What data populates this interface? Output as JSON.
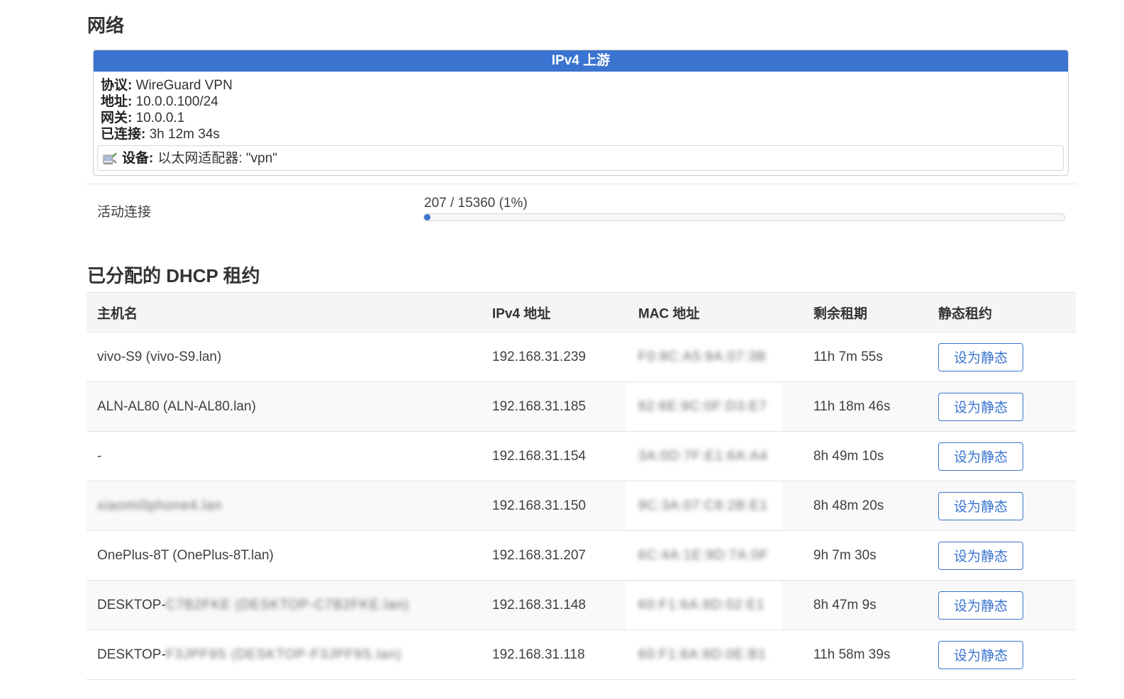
{
  "network": {
    "title": "网络",
    "upstream": {
      "header": "IPv4 上游",
      "protocol_label": "协议:",
      "protocol_value": "WireGuard VPN",
      "address_label": "地址:",
      "address_value": "10.0.0.100/24",
      "gateway_label": "网关:",
      "gateway_value": "10.0.0.1",
      "connected_label": "已连接:",
      "connected_value": "3h 12m 34s",
      "device_label": "设备:",
      "device_value": "以太网适配器: \"vpn\"",
      "device_icon": "ethernet-adapter-icon"
    },
    "active_connections": {
      "label": "活动连接",
      "value": "207 / 15360 (1%)",
      "percent": 1
    }
  },
  "dhcp": {
    "title": "已分配的 DHCP 租约",
    "columns": {
      "host": "主机名",
      "ip": "IPv4 地址",
      "mac": "MAC 地址",
      "lease": "剩余租期",
      "static": "静态租约"
    },
    "rows": [
      {
        "host": "vivo-S9 (vivo-S9.lan)",
        "host_blur": "",
        "ip": "192.168.31.239",
        "mac": "F0:8C:A5:9A:07:3B",
        "lease": "11h 7m 55s",
        "button": "设为静态"
      },
      {
        "host": "ALN-AL80 (ALN-AL80.lan)",
        "host_blur": "",
        "ip": "192.168.31.185",
        "mac": "82:6E:9C:0F:D3:E7",
        "lease": "11h 18m 46s",
        "button": "设为静态"
      },
      {
        "host": "-",
        "host_blur": "",
        "ip": "192.168.31.154",
        "mac": "3A:0D:7F:E1:6A:A4",
        "lease": "8h 49m 10s",
        "button": "设为静态"
      },
      {
        "host": "",
        "host_blur": "xiaomi0phone4.lan",
        "ip": "192.168.31.150",
        "mac": "9C:3A:07:C8:2B:E1",
        "lease": "8h 48m 20s",
        "button": "设为静态"
      },
      {
        "host": "OnePlus-8T (OnePlus-8T.lan)",
        "host_blur": "",
        "ip": "192.168.31.207",
        "mac": "6C:4A:1E:9D:7A:0F",
        "lease": "9h 7m 30s",
        "button": "设为静态"
      },
      {
        "host": "DESKTOP-",
        "host_blur": "C7B2FKE (DESKTOP-C7B2FKE.lan)",
        "ip": "192.168.31.148",
        "mac": "60:F1:6A:8D:02:E1",
        "lease": "8h 47m 9s",
        "button": "设为静态"
      },
      {
        "host": "DESKTOP-",
        "host_blur": "F3JPF9S (DESKTOP-F3JPF9S.lan)",
        "ip": "192.168.31.118",
        "mac": "60:F1:6A:8D:0E:B1",
        "lease": "11h 58m 39s",
        "button": "设为静态"
      }
    ]
  }
}
